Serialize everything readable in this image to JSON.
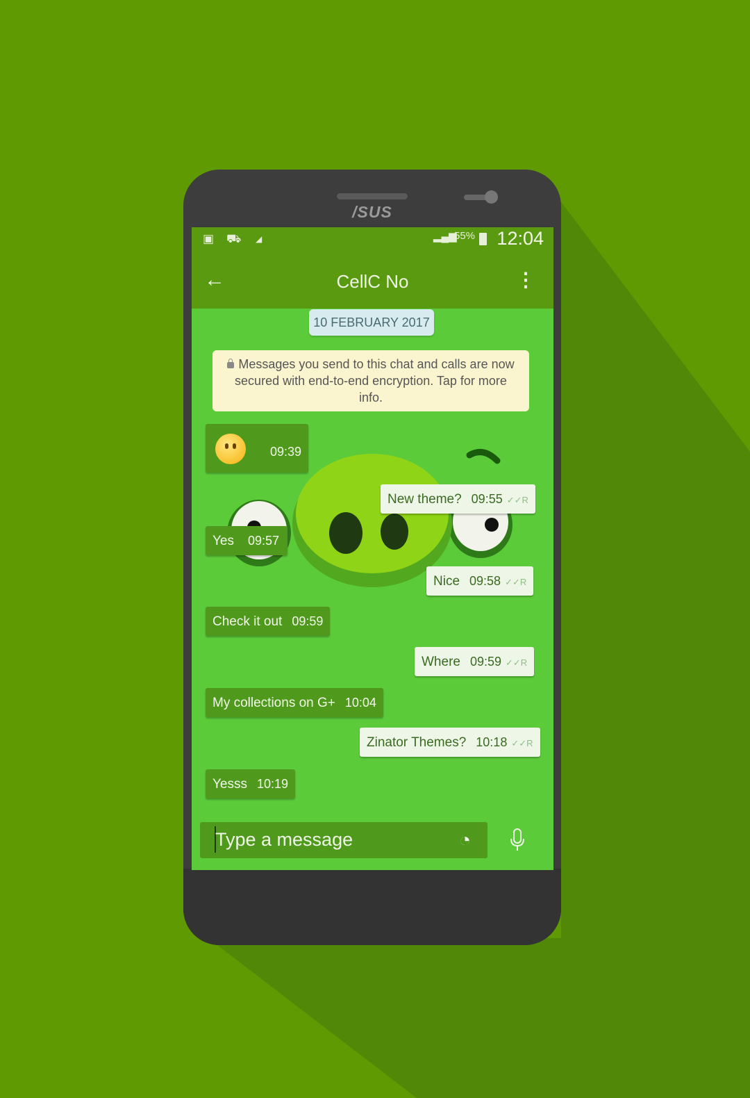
{
  "device": {
    "brand": "/SUS"
  },
  "statusbar": {
    "battery": "55%",
    "time": "12:04"
  },
  "appbar": {
    "title": "CellC No"
  },
  "chat": {
    "date": "10 FEBRUARY 2017",
    "encryption_notice": "Messages you send to this chat and calls are now secured with end-to-end encryption. Tap for more info.",
    "messages": [
      {
        "direction": "in",
        "text": "",
        "time": "09:39",
        "emoji": "slightly-smiling-face"
      },
      {
        "direction": "out",
        "text": "New theme?",
        "time": "09:55",
        "ticks": "✓✓R"
      },
      {
        "direction": "in",
        "text": "Yes",
        "time": "09:57"
      },
      {
        "direction": "out",
        "text": "Nice",
        "time": "09:58",
        "ticks": "✓✓R"
      },
      {
        "direction": "in",
        "text": "Check it out",
        "time": "09:59"
      },
      {
        "direction": "out",
        "text": "Where",
        "time": "09:59",
        "ticks": "✓✓R"
      },
      {
        "direction": "in",
        "text": "My collections on G+",
        "time": "10:04"
      },
      {
        "direction": "out",
        "text": "Zinator Themes?",
        "time": "10:18",
        "ticks": "✓✓R"
      },
      {
        "direction": "in",
        "text": "Yesss",
        "time": "10:19"
      }
    ]
  },
  "composer": {
    "placeholder": "Type a message"
  },
  "colors": {
    "background": "#5f9a02",
    "appbar": "#5a9a10",
    "chat": "#5ccb3a",
    "incoming": "#4f9a1c",
    "outgoing": "#eef6e8"
  }
}
